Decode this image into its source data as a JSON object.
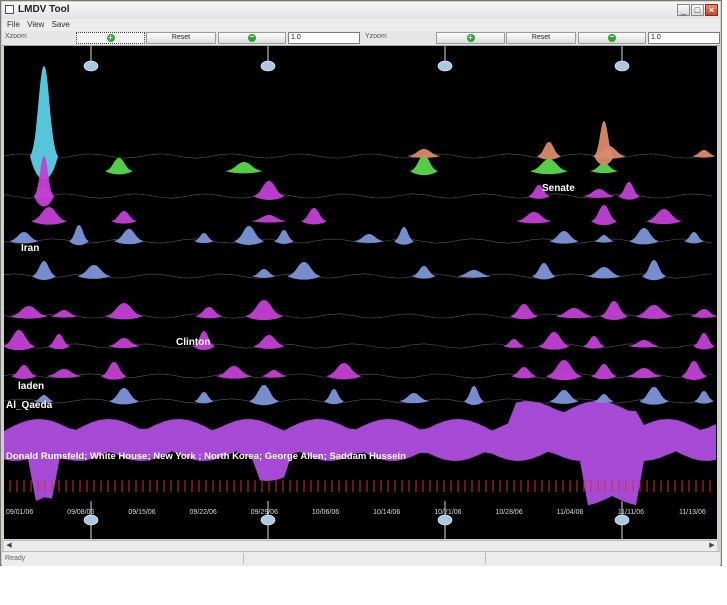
{
  "window": {
    "title": "LMDV Tool"
  },
  "menu": {
    "items": [
      "File",
      "View",
      "Save"
    ]
  },
  "toolbar": {
    "xzoom_label": "Xzoom",
    "yzoom_label": "Yzoom",
    "reset_label": "Reset",
    "xzoom_value": "1.0",
    "yzoom_value": "1.0"
  },
  "chart": {
    "dates": [
      "09/01/06",
      "09/08/06",
      "09/15/06",
      "09/22/06",
      "09/29/06",
      "10/06/06",
      "10/14/06",
      "10/21/06",
      "10/28/06",
      "11/04/06",
      "11/11/06",
      "11/13/06"
    ],
    "labels": {
      "senate": "Senate",
      "iran": "Iran",
      "clinton": "Clinton",
      "laden": "laden",
      "al_qaeda": "Al_Qaeda",
      "bottom": "Donald Rumsfeld; White House; New York ; North Korea; George Allen; Saddam Hussein"
    },
    "colors": {
      "background": "#000000",
      "violet": "#a64ad6",
      "magenta": "#c43fd6",
      "blue": "#7c95d9",
      "green": "#58d94a",
      "salmon": "#d98a6a",
      "cyan": "#5ad0e6",
      "tick": "#d23030",
      "slider": "#a9c7e6"
    }
  },
  "status": {
    "text": "Ready"
  }
}
